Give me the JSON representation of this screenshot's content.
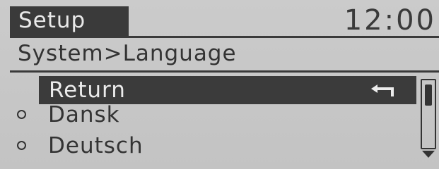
{
  "header": {
    "title": "Setup",
    "clock": "12:00"
  },
  "breadcrumb": "System>Language",
  "menu": {
    "items": [
      {
        "label": "Return",
        "icon": "return-arrow-icon",
        "selected": true
      },
      {
        "label": "Dansk",
        "selected": false
      },
      {
        "label": "Deutsch",
        "selected": false
      }
    ]
  },
  "colors": {
    "background": "#c6c6c6",
    "foreground": "#3a3a3a",
    "highlight_text": "#ececec"
  }
}
